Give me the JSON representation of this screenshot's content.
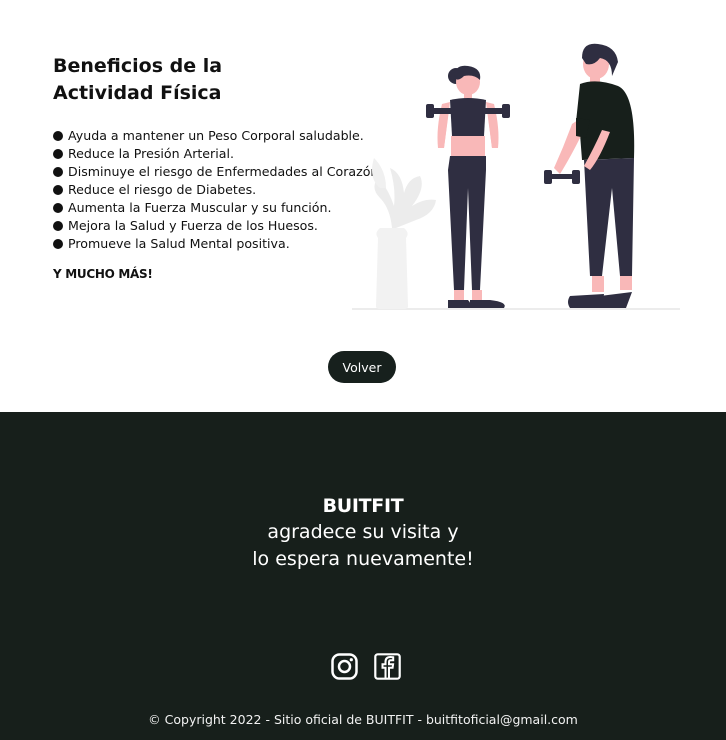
{
  "main": {
    "title_line1": "Beneficios de la",
    "title_line2": "Actividad Física",
    "benefits": [
      "Ayuda a mantener un Peso Corporal saludable.",
      "Reduce la Presión Arterial.",
      "Disminuye el riesgo de Enfermedades al Corazón.",
      "Reduce el riesgo de Diabetes.",
      "Aumenta la Fuerza Muscular y su función.",
      "Mejora la Salud y Fuerza de los Huesos.",
      "Promueve la Salud Mental positiva."
    ],
    "more_text": "Y MUCHO MÁS!",
    "back_button": "Volver"
  },
  "footer": {
    "brand": "BUITFIT",
    "thanks_line1": "agradece su visita y",
    "thanks_line2": "lo espera nuevamente!",
    "social": [
      "instagram-icon",
      "facebook-icon"
    ],
    "copyright": "© Copyright 2022 - Sitio oficial de BUITFIT - buitfitoficial@gmail.com"
  },
  "colors": {
    "dark": "#171f1b",
    "skin": "#f9b8b8",
    "clothes": "#2f2e41",
    "plant": "#f2f2f2"
  }
}
